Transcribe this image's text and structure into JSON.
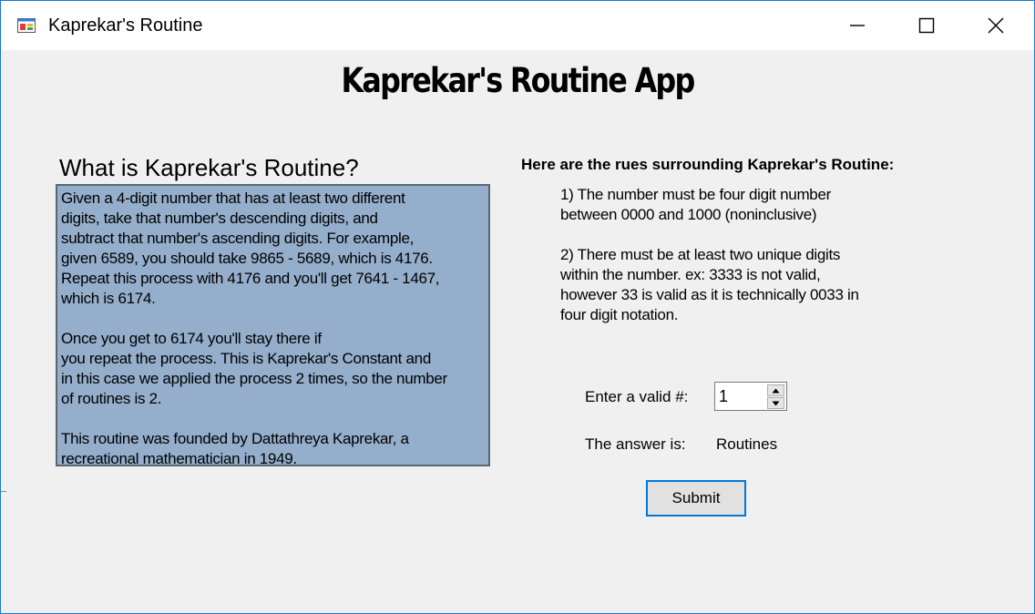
{
  "window": {
    "title": "Kaprekar's Routine",
    "controls": {
      "minimize_icon": "minimize-icon",
      "maximize_icon": "maximize-icon",
      "close_icon": "close-icon"
    }
  },
  "main": {
    "heading": "Kaprekar's Routine App",
    "what_title": "What is Kaprekar's Routine?",
    "description": [
      "Given a 4-digit number that has at least two different\ndigits, take that number's descending digits, and\nsubtract that number's ascending digits. For example,\ngiven 6589, you should take 9865 - 5689, which is 4176.\nRepeat this process with 4176 and you'll get 7641 - 1467,\nwhich is 6174.",
      "Once you get to 6174 you'll stay there if\nyou repeat the process. This is Kaprekar's Constant and\nin this case we applied the process 2 times, so the number\nof routines is 2.",
      "This routine was founded by Dattathreya Kaprekar, a\nrecreational mathematician in 1949."
    ],
    "rules_title": "Here are the rues surrounding Kaprekar's Routine:",
    "rules": [
      "1) The number must be four digit number\nbetween 0000 and 1000 (noninclusive)",
      "2) There must be at least two unique digits\nwithin the number. ex: 3333 is not valid,\nhowever 33 is valid as it is technically 0033 in\nfour digit notation."
    ]
  },
  "form": {
    "enter_label": "Enter a valid #:",
    "number_value": "1",
    "answer_label": "The answer is:",
    "answer_value": "Routines",
    "submit_label": "Submit"
  },
  "colors": {
    "description_bg": "#94aecb",
    "accent_border": "#0078d7",
    "window_bg": "#f0f0f0"
  }
}
